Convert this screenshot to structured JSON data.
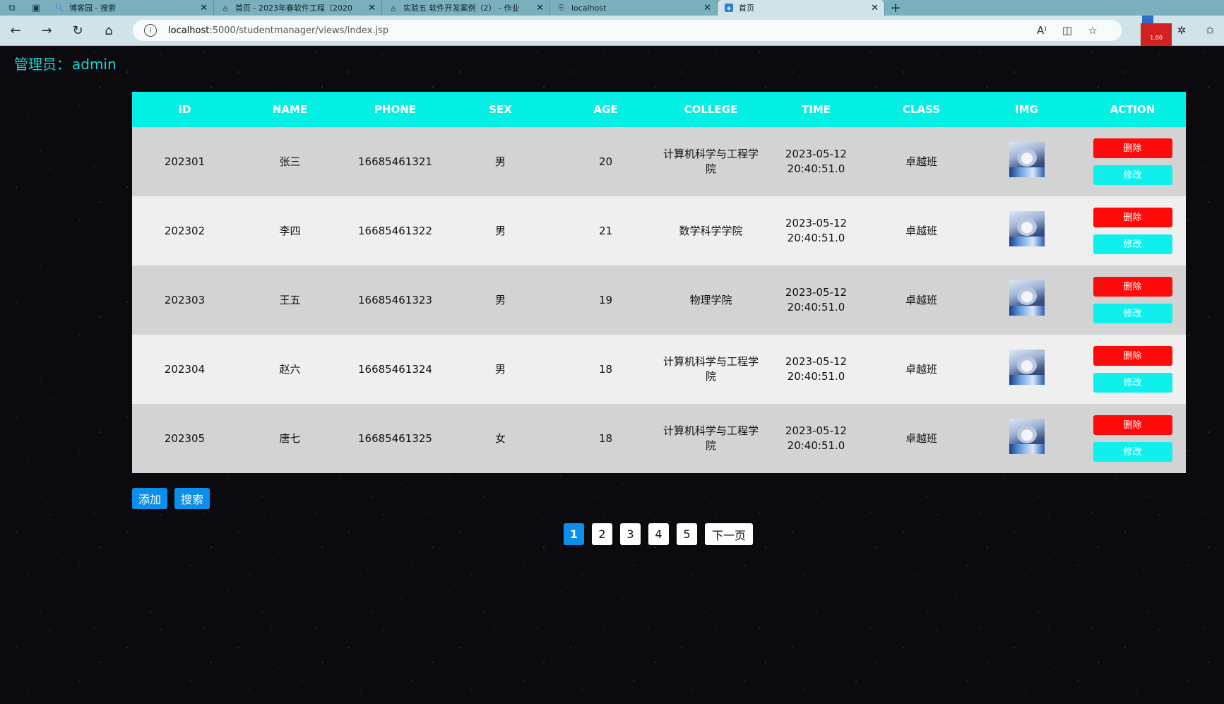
{
  "browser": {
    "tabs": [
      {
        "title": "博客园 - 搜索",
        "icon": "search-icon"
      },
      {
        "title": "首页 - 2023年春软件工程（2020",
        "icon": "shield-logo-icon"
      },
      {
        "title": "实验五 软件开发案例（2） - 作业",
        "icon": "shield-logo-icon"
      },
      {
        "title": "localhost",
        "icon": "lock-page-icon"
      },
      {
        "title": "首页",
        "icon": "app-tab-icon"
      }
    ],
    "url_host": "localhost",
    "url_path": ":5000/studentmanager/views/index.jsp",
    "extension_badge": "1.00"
  },
  "admin": {
    "label": "管理员：",
    "name": "admin"
  },
  "table": {
    "headers": [
      "ID",
      "NAME",
      "PHONE",
      "SEX",
      "AGE",
      "COLLEGE",
      "TIME",
      "CLASS",
      "IMG",
      "ACTION"
    ],
    "delete_label": "删除",
    "modify_label": "修改",
    "rows": [
      {
        "id": "202301",
        "name": "张三",
        "phone": "16685461321",
        "sex": "男",
        "age": "20",
        "college": "计算机科学与工程学院",
        "time_date": "2023-05-12",
        "time_clock": "20:40:51.0",
        "class": "卓越班"
      },
      {
        "id": "202302",
        "name": "李四",
        "phone": "16685461322",
        "sex": "男",
        "age": "21",
        "college": "数学科学学院",
        "time_date": "2023-05-12",
        "time_clock": "20:40:51.0",
        "class": "卓越班"
      },
      {
        "id": "202303",
        "name": "王五",
        "phone": "16685461323",
        "sex": "男",
        "age": "19",
        "college": "物理学院",
        "time_date": "2023-05-12",
        "time_clock": "20:40:51.0",
        "class": "卓越班"
      },
      {
        "id": "202304",
        "name": "赵六",
        "phone": "16685461324",
        "sex": "男",
        "age": "18",
        "college": "计算机科学与工程学院",
        "time_date": "2023-05-12",
        "time_clock": "20:40:51.0",
        "class": "卓越班"
      },
      {
        "id": "202305",
        "name": "唐七",
        "phone": "16685461325",
        "sex": "女",
        "age": "18",
        "college": "计算机科学与工程学院",
        "time_date": "2023-05-12",
        "time_clock": "20:40:51.0",
        "class": "卓越班"
      }
    ]
  },
  "actions": {
    "add": "添加",
    "search": "搜索"
  },
  "pagination": {
    "pages": [
      "1",
      "2",
      "3",
      "4",
      "5"
    ],
    "current": "1",
    "next": "下一页"
  },
  "colors": {
    "header_bg": "#05f0e4",
    "delete": "#ff0a0a",
    "modify": "#0ff0ec",
    "primary": "#0c8fea",
    "admin_text": "#18d6d6"
  }
}
